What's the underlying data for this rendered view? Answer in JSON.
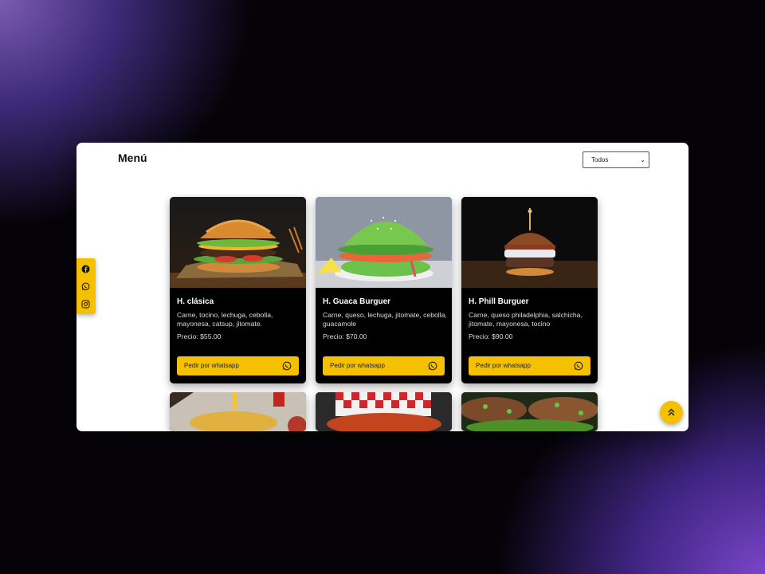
{
  "header": {
    "title": "Menú"
  },
  "filter": {
    "selected": "Todos"
  },
  "cards": [
    {
      "name": "H. clásica",
      "description": "Carne, tocino, lechuga, cebolla, mayonesa, catsup, jitomate.",
      "price": "Precio: $55.00",
      "button": "Pedir por whatsapp"
    },
    {
      "name": "H. Guaca Burguer",
      "description": "Carne, queso, lechuga, jitomate, cebolla, guacamole",
      "price": "Precio: $70.00",
      "button": "Pedir por whatsapp"
    },
    {
      "name": "H. Phill Burguer",
      "description": "Carne, queso philadelphia, salchicha, jitomate, mayonesa, tocino",
      "price": "Precio: $90.00",
      "button": "Pedir por whatsapp"
    }
  ],
  "icons": {
    "social": [
      "facebook-icon",
      "whatsapp-icon",
      "instagram-icon"
    ],
    "scroll_top": "double-chevron-up-icon"
  },
  "colors": {
    "accent": "#f5c000",
    "card_bg": "#000000"
  }
}
